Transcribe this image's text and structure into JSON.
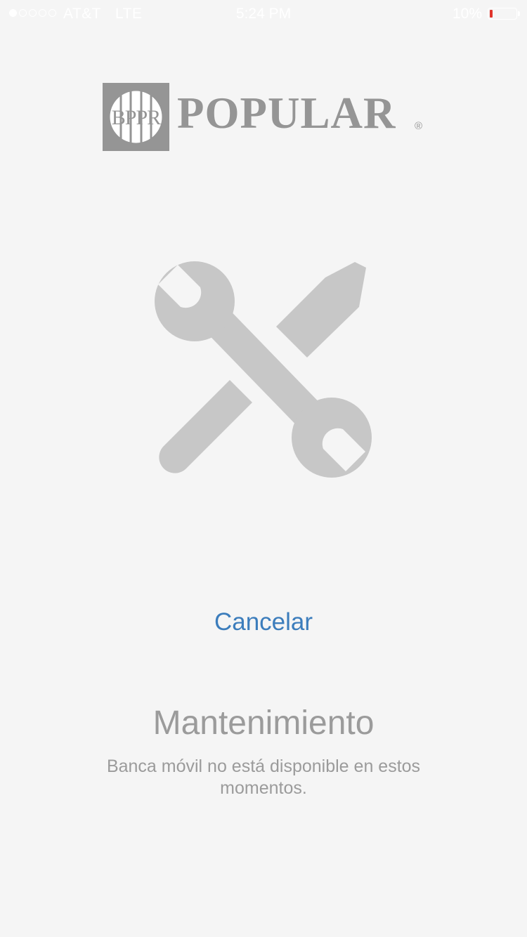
{
  "status_bar": {
    "carrier": "AT&T",
    "network": "LTE",
    "time": "5:24 PM",
    "battery_percent_text": "10%",
    "battery_level": 0.1,
    "signal_bars_filled": 1,
    "signal_bars_total": 5,
    "battery_color": "#e0342b"
  },
  "logo": {
    "mark_text": "BPPR",
    "wordmark": "POPULAR",
    "registered": "®"
  },
  "illustration": {
    "icon": "wrench-screwdriver-icon",
    "color": "#c7c7c7"
  },
  "actions": {
    "cancel_label": "Cancelar",
    "cancel_color": "#3c7dbc"
  },
  "message": {
    "title": "Mantenimiento",
    "body": "Banca móvil no está disponible en estos momentos."
  }
}
